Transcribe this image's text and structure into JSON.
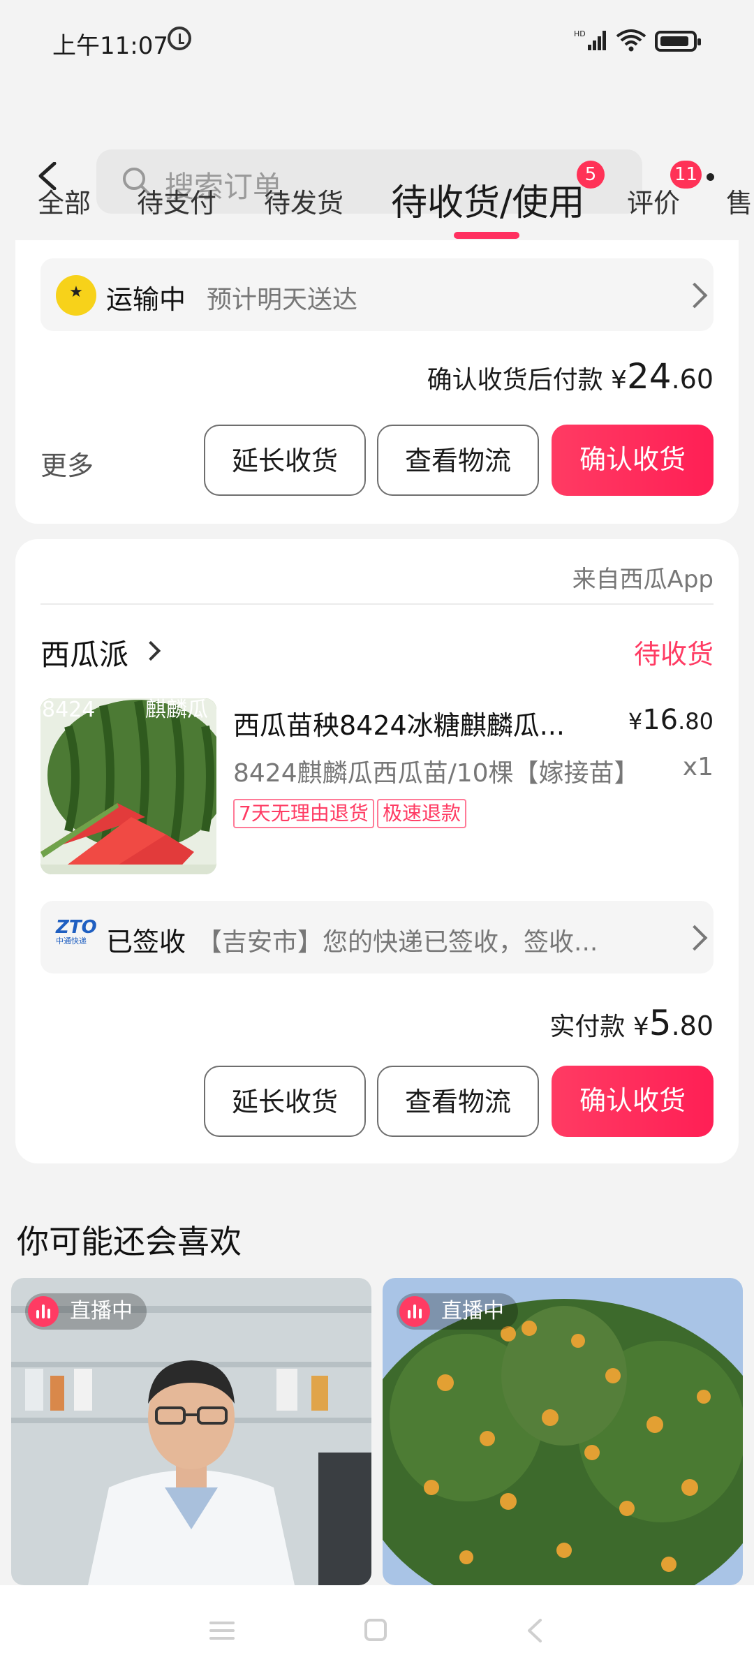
{
  "status": {
    "time": "上午11:07",
    "signal_label": "HD"
  },
  "search": {
    "placeholder": "搜索订单"
  },
  "tabs": [
    {
      "label": "全部"
    },
    {
      "label": "待支付"
    },
    {
      "label": "待发货"
    },
    {
      "label": "待收货/使用",
      "badge": "5"
    },
    {
      "label": "评价",
      "badge": "11"
    },
    {
      "label": "售"
    }
  ],
  "order1": {
    "ship_status": "运输中",
    "ship_detail": "预计明天送达",
    "pay_label": "确认收货后付款 ¥",
    "pay_int": "24",
    "pay_dec": ".60",
    "more": "更多",
    "btn_extend": "延长收货",
    "btn_logistics": "查看物流",
    "btn_confirm": "确认收货"
  },
  "order2": {
    "source": "来自西瓜App",
    "shop": "西瓜派",
    "status": "待收货",
    "product_title": "西瓜苗秧8424冰糖麒麟瓜...",
    "product_spec": "8424麒麟瓜西瓜苗/10棵【嫁接苗】",
    "image_text_left": "8424",
    "image_text_right": "麒麟瓜",
    "price_sym": "¥",
    "price_int": "16",
    "price_dec": ".80",
    "qty": "x1",
    "tags": [
      "7天无理由退货",
      "极速退款"
    ],
    "ship_status": "已签收",
    "ship_detail": "【吉安市】您的快递已签收，签收...",
    "paid_label": "实付款 ¥",
    "paid_int": "5",
    "paid_dec": ".80",
    "btn_extend": "延长收货",
    "btn_logistics": "查看物流",
    "btn_confirm": "确认收货",
    "courier_logo_text": "ZTO",
    "courier_logo_sub": "中通快递"
  },
  "recommend": {
    "title": "你可能还会喜欢",
    "items": [
      {
        "live_label": "直播中"
      },
      {
        "live_label": "直播中"
      }
    ]
  },
  "colors": {
    "accent": "#ff2f5f",
    "bg": "#f3f3f3"
  }
}
